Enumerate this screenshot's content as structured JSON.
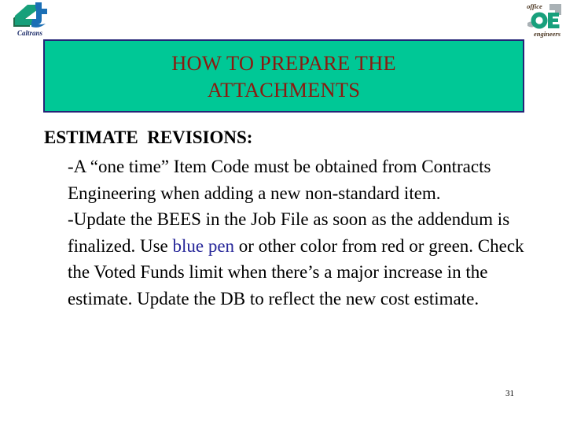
{
  "slide": {
    "title": {
      "line1": "HOW TO PREPARE THE",
      "line2": "ATTACHMENTS",
      "text_color": "#8B1A10",
      "fill_color": "#00C896",
      "border_color": "#242477"
    },
    "body": {
      "heading": "ESTIMATE  REVISIONS:",
      "paragraph1": "-A “one time” Item Code must be obtained from Contracts Engineering when adding a new non-standard item.",
      "paragraph2_before": "-Update the BEES in the Job File as soon as the addendum is finalized.  Use ",
      "paragraph2_highlight": "blue pen",
      "paragraph2_after": " or other color from red or green.  Check the Voted Funds limit when there’s a  major increase in the estimate.  Update the DB to reflect the new cost estimate.",
      "highlight_color": "#262699"
    },
    "page_number": "31",
    "logos": {
      "left": {
        "name": "caltrans-logo",
        "wordmark": "Caltrans"
      },
      "right": {
        "name": "office-engineers-logo",
        "top_word": "office",
        "monogram": "OE",
        "bottom_word": "engineers"
      }
    }
  }
}
